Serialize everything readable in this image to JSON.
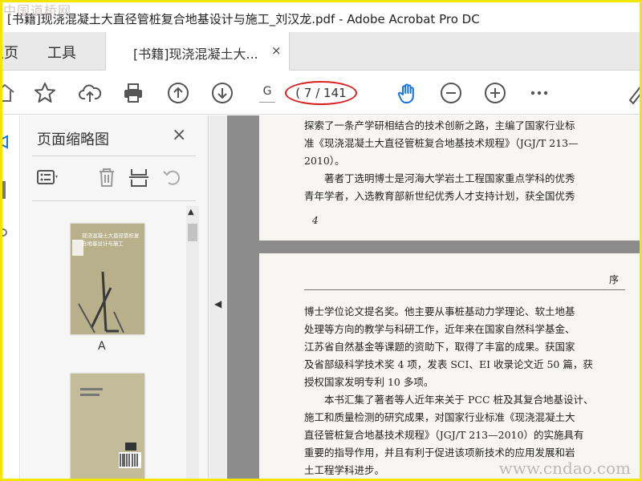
{
  "watermarks": {
    "top_left": "中国道桥网",
    "bottom_right": "www.cndao.com"
  },
  "window": {
    "title": "[书籍]现浇混凝土大直径管桩复合地基设计与施工_刘汉龙.pdf - Adobe Acrobat Pro DC"
  },
  "tabs": {
    "home_label": "主页",
    "tools_label": "工具",
    "document_tab_label": "[书籍]现浇混凝土大...",
    "document_tab_close": "×"
  },
  "toolbar": {
    "icons": [
      "home-icon",
      "bookmark-star-icon",
      "upload-cloud-icon",
      "print-icon",
      "previous-page-icon",
      "next-page-icon",
      "hand-tool-icon",
      "zoom-out-icon",
      "zoom-in-icon",
      "more-icon",
      "pen-icon"
    ],
    "page_field_value": "G",
    "page_indicator": "( 7 / 141",
    "accent_color": "#1473e6",
    "highlight_color": "#d92020"
  },
  "thumbnails_panel": {
    "title": "页面缩略图",
    "close": "×",
    "tool_icons": [
      "page-options-icon",
      "delete-icon",
      "extract-icon",
      "rotate-icon"
    ],
    "pages": [
      {
        "label": "A",
        "cover_text": "现浇混凝土大直径管桩复合地基设计与施工"
      },
      {
        "label": "",
        "cover_text": ""
      }
    ]
  },
  "document": {
    "page_a": {
      "lines": [
        "探索了一条产学研相结合的技术创新之路，主编了国家行业标",
        "准《现浇混凝土大直径管桩复合地基技术规程》（JGJ/T 213—",
        "2010）。",
        "著者丁选明博士是河海大学岩土工程国家重点学科的优秀",
        "青年学者，入选教育部新世纪优秀人才支持计划，获全国优秀"
      ],
      "page_number": "4"
    },
    "page_b": {
      "header": "序",
      "paragraph_1": [
        "博士学位论文提名奖。他主要从事桩基动力学理论、软土地基",
        "处理等方向的教学与科研工作，近年来在国家自然科学基金、",
        "江苏省自然基金等课题的资助下，取得了丰富的成果。获国家",
        "及省部级科学技术奖 4 项，发表 SCI、EI 收录论文近 50 篇，获",
        "授权国家发明专利 10 多项。"
      ],
      "paragraph_2": [
        "本书汇集了著者等人近年来关于 PCC 桩及其复合地基设计、",
        "施工和质量检测的研究成果，对国家行业标准《现浇混凝土大",
        "直径管桩复合地基技术规程》（JGJ/T 213—2010）的实施具有",
        "重要的指导作用，并且有利于促进该项新技术的应用发展和岩",
        "土工程学科进步。"
      ]
    }
  }
}
